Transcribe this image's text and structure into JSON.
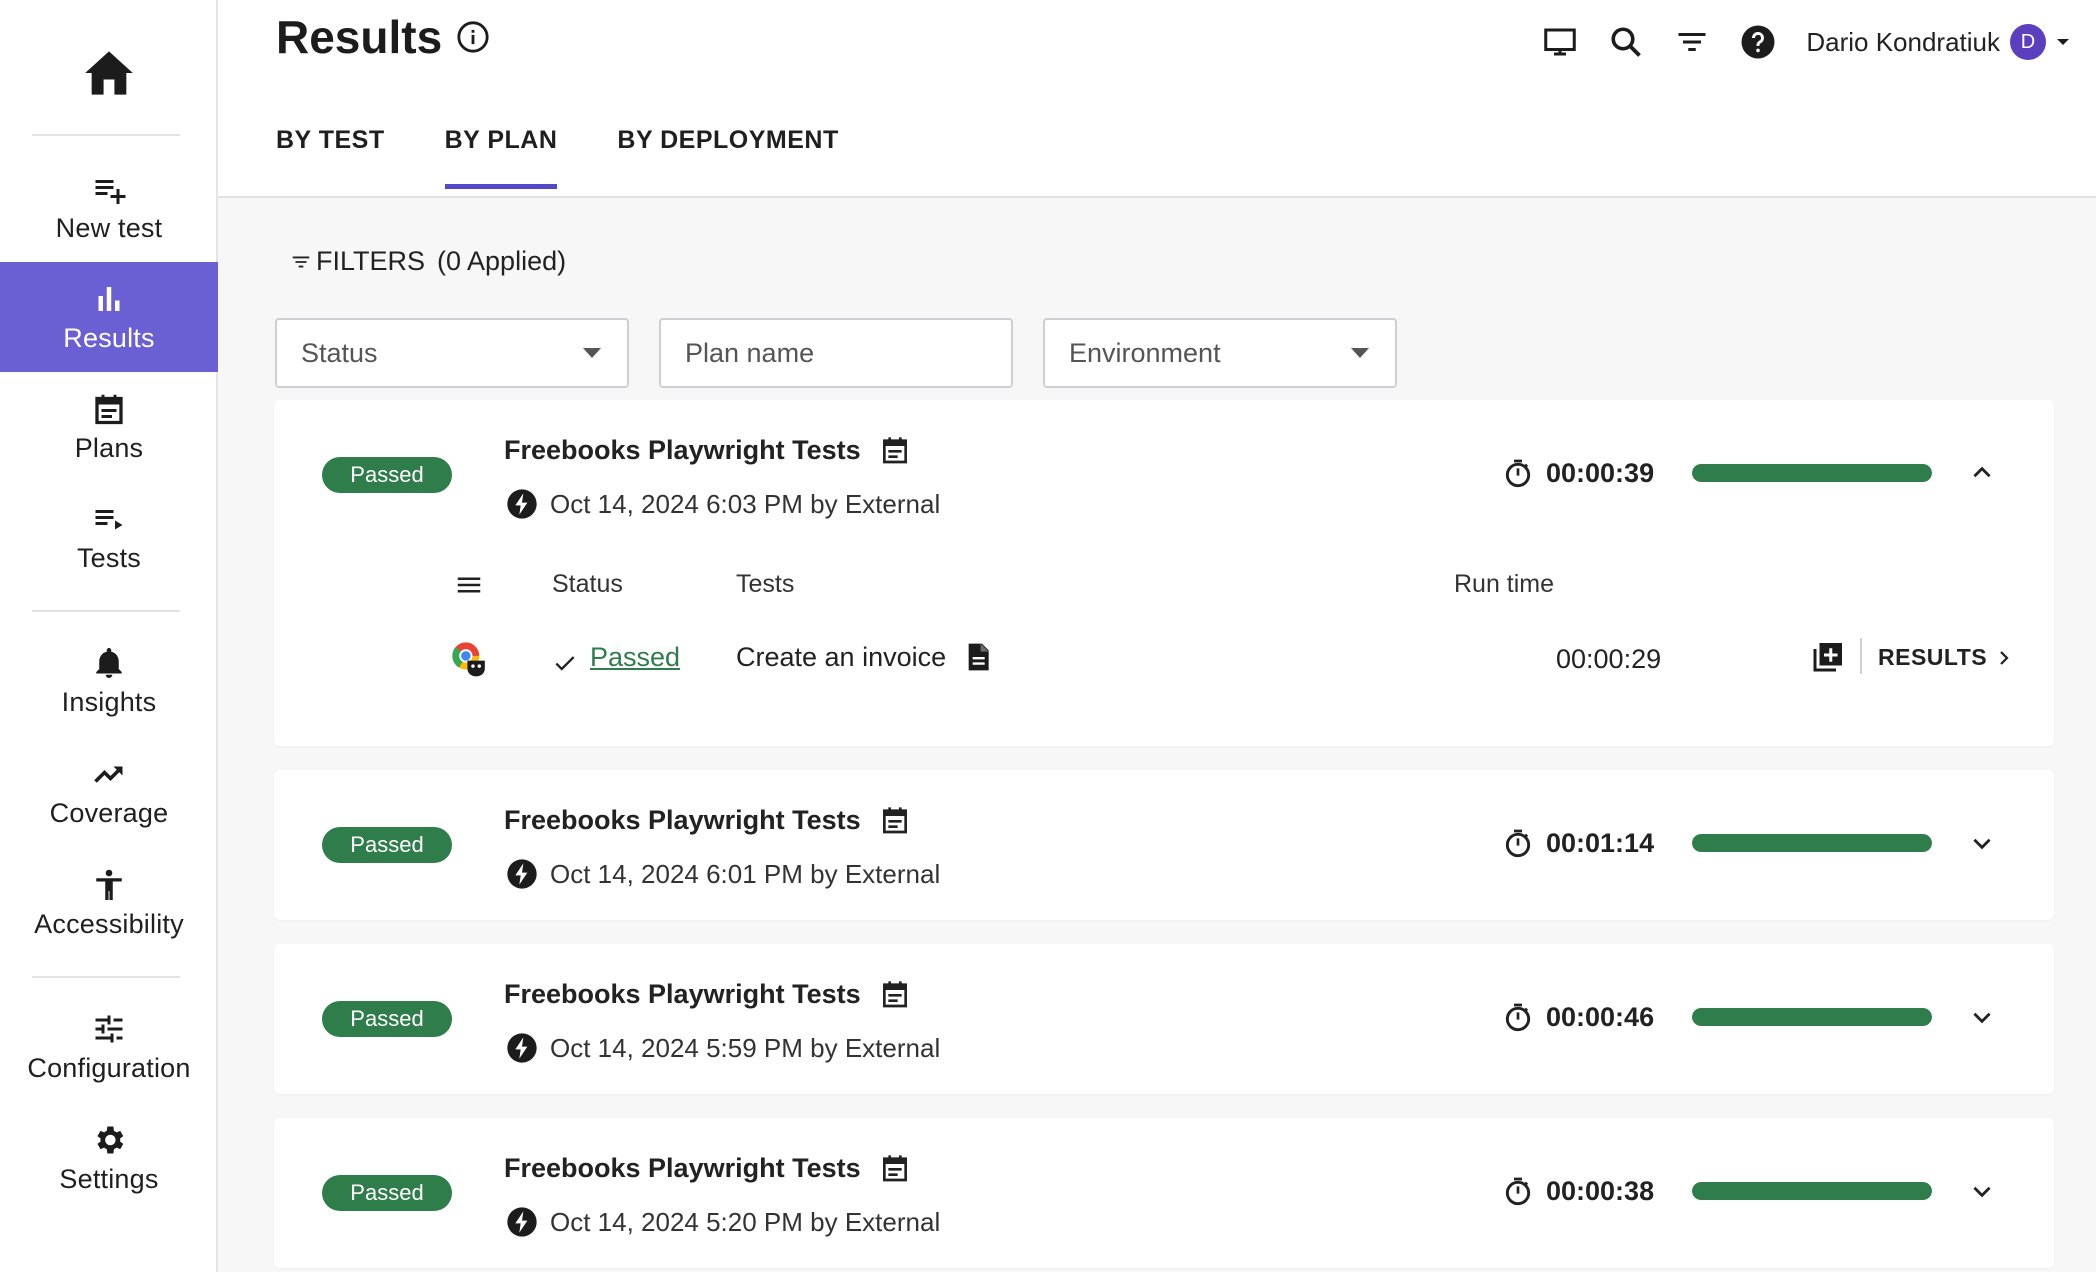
{
  "sidebar": {
    "home_icon": "home-icon",
    "items": [
      {
        "label": "New test",
        "icon": "playlist-add-icon"
      },
      {
        "label": "Results",
        "icon": "bar-chart-icon",
        "active": true
      },
      {
        "label": "Plans",
        "icon": "calendar-icon"
      },
      {
        "label": "Tests",
        "icon": "playlist-play-icon"
      },
      {
        "label": "Insights",
        "icon": "bell-icon"
      },
      {
        "label": "Coverage",
        "icon": "trending-up-icon"
      },
      {
        "label": "Accessibility",
        "icon": "accessibility-icon"
      },
      {
        "label": "Configuration",
        "icon": "sliders-icon"
      },
      {
        "label": "Settings",
        "icon": "gear-icon"
      }
    ],
    "active_color": "#6a5fd3"
  },
  "header": {
    "title": "Results",
    "user_name": "Dario Kondratiuk",
    "avatar_initial": "D",
    "icons": [
      "monitor-icon",
      "search-icon",
      "filter-icon",
      "help-icon"
    ]
  },
  "tabs": [
    {
      "label": "BY TEST",
      "active": false
    },
    {
      "label": "BY PLAN",
      "active": true
    },
    {
      "label": "BY DEPLOYMENT",
      "active": false
    }
  ],
  "filters": {
    "label": "FILTERS",
    "applied": "(0 Applied)",
    "status_placeholder": "Status",
    "plan_name_placeholder": "Plan name",
    "environment_placeholder": "Environment"
  },
  "plans": [
    {
      "badge": "Passed",
      "title": "Freebooks Playwright Tests",
      "subtitle": "Oct 14, 2024 6:03 PM by External",
      "duration": "00:00:39",
      "progress": 1.0,
      "expanded": true,
      "table": {
        "headers": {
          "status": "Status",
          "tests": "Tests",
          "run_time": "Run time"
        },
        "rows": [
          {
            "status": "Passed",
            "test": "Create an invoice",
            "run_time": "00:00:29",
            "results_label": "RESULTS"
          }
        ]
      }
    },
    {
      "badge": "Passed",
      "title": "Freebooks Playwright Tests",
      "subtitle": "Oct 14, 2024 6:01 PM by External",
      "duration": "00:01:14",
      "progress": 1.0,
      "expanded": false
    },
    {
      "badge": "Passed",
      "title": "Freebooks Playwright Tests",
      "subtitle": "Oct 14, 2024 5:59 PM by External",
      "duration": "00:00:46",
      "progress": 1.0,
      "expanded": false
    },
    {
      "badge": "Passed",
      "title": "Freebooks Playwright Tests",
      "subtitle": "Oct 14, 2024 5:20 PM by External",
      "duration": "00:00:38",
      "progress": 1.0,
      "expanded": false
    }
  ],
  "colors": {
    "passed": "#2f7d4b",
    "accent": "#5547c7"
  }
}
